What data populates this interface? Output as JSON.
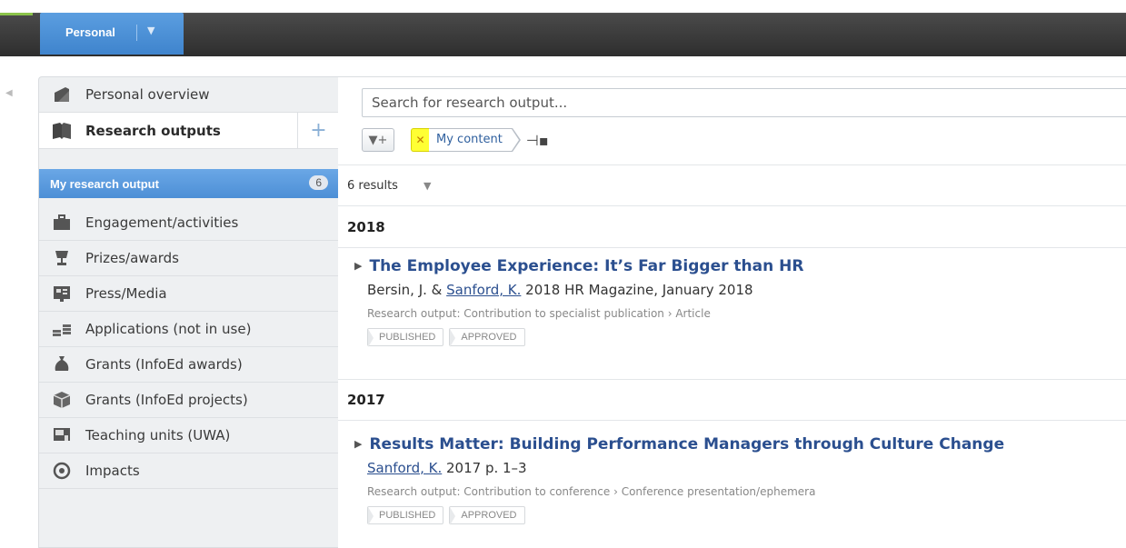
{
  "header": {
    "context_label": "Personal",
    "context_dropdown_icon": "chevron-down-icon",
    "accent_color": "#4a8fd8"
  },
  "sidebar": {
    "items": [
      {
        "label": "Personal overview",
        "icon": "overview-icon"
      },
      {
        "label": "Research outputs",
        "icon": "books-icon",
        "active": true
      },
      {
        "label": "Engagement/activities",
        "icon": "briefcase-icon"
      },
      {
        "label": "Prizes/awards",
        "icon": "trophy-icon"
      },
      {
        "label": "Press/Media",
        "icon": "newspaper-icon"
      },
      {
        "label": "Applications (not in use)",
        "icon": "coins-icon"
      },
      {
        "label": "Grants (InfoEd awards)",
        "icon": "money-bag-icon"
      },
      {
        "label": "Grants (InfoEd projects)",
        "icon": "package-icon"
      },
      {
        "label": "Teaching units (UWA)",
        "icon": "classroom-icon"
      },
      {
        "label": "Impacts",
        "icon": "target-icon"
      }
    ],
    "add_label": "+",
    "subitem": {
      "label": "My research output",
      "count": "6"
    }
  },
  "main": {
    "search_placeholder": "Search for research output...",
    "filter_chip": "My content",
    "results_count": "6 results",
    "groups": [
      {
        "year": "2018",
        "entries": [
          {
            "title": "The Employee Experience: It’s Far Bigger than HR",
            "byline_pre": "Bersin, J. & ",
            "author_link": "Sanford, K.",
            "byline_post": " 2018 HR Magazine, January 2018",
            "type": "Research output: Contribution to specialist publication › Article",
            "tags": [
              "PUBLISHED",
              "APPROVED"
            ]
          }
        ]
      },
      {
        "year": "2017",
        "entries": [
          {
            "title": "Results Matter: Building Performance Managers through Culture Change",
            "byline_pre": "",
            "author_link": "Sanford, K.",
            "byline_post": " 2017 p. 1–3",
            "type": "Research output: Contribution to conference › Conference presentation/ephemera",
            "tags": [
              "PUBLISHED",
              "APPROVED"
            ]
          }
        ]
      }
    ]
  }
}
